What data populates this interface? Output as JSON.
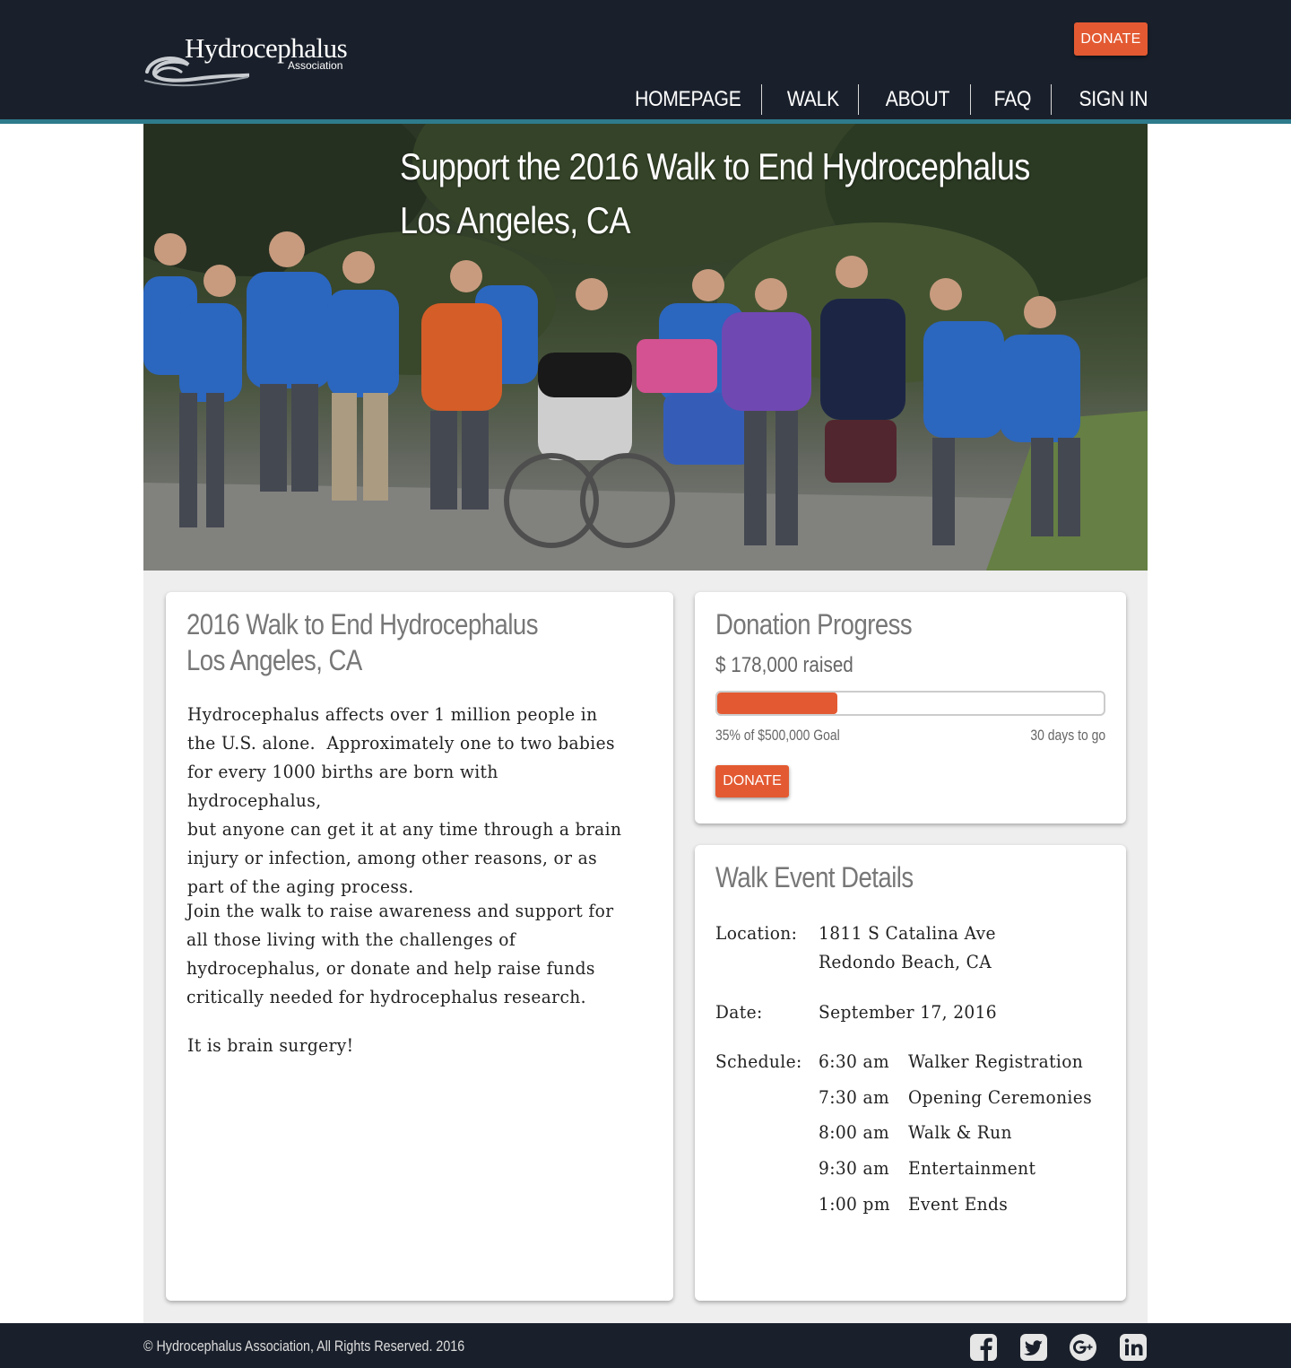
{
  "header": {
    "logo_text": "Hydrocephalus",
    "logo_sub": "Association",
    "donate_label": "DONATE",
    "nav": [
      "HOMEPAGE",
      "WALK",
      "ABOUT",
      "FAQ",
      "SIGN IN"
    ]
  },
  "hero": {
    "title_line1": "Support the 2016 Walk to End Hydrocephalus",
    "title_line2": "Los Angeles, CA"
  },
  "about_card": {
    "title_line1": "2016 Walk to End Hydrocephalus",
    "title_line2": "Los Angeles, CA",
    "paragraph1_lines": [
      "Hydrocephalus affects over 1 million people in",
      "the U.S. alone.  Approximately one to two babies",
      "for every 1000 births are born with hydrocephalus,",
      "but anyone can get it at any time through a brain",
      "injury or infection, among other reasons, or as",
      "part of the aging process."
    ],
    "paragraph2_lines": [
      "Join the walk to raise awareness and support for",
      "all those living with the challenges of",
      "hydrocephalus, or donate and help raise funds",
      "critically needed for hydrocephalus research."
    ],
    "paragraph3": "It is brain surgery!"
  },
  "progress_card": {
    "title": "Donation Progress",
    "raised": "$ 178,000 raised",
    "progress_fraction": 0.31,
    "goal_text": "35% of $500,000 Goal",
    "days_text": "30 days to go",
    "donate_label": "DONATE"
  },
  "details_card": {
    "title": "Walk Event Details",
    "location_label": "Location:",
    "location_line1": "1811 S Catalina Ave",
    "location_line2": "Redondo Beach, CA",
    "date_label": "Date:",
    "date_value": "September 17, 2016",
    "schedule_label": "Schedule:",
    "schedule": [
      {
        "time": "6:30 am",
        "event": "Walker Registration"
      },
      {
        "time": "7:30 am",
        "event": "Opening Ceremonies"
      },
      {
        "time": "8:00 am",
        "event": "Walk & Run"
      },
      {
        "time": "9:30 am",
        "event": "Entertainment"
      },
      {
        "time": "1:00 pm",
        "event": "Event Ends"
      }
    ]
  },
  "footer": {
    "copyright": "©  Hydrocephalus Association, All Rights Reserved. 2016",
    "social": [
      "facebook-icon",
      "twitter-icon",
      "google-plus-icon",
      "linkedin-icon"
    ]
  },
  "colors": {
    "header_bg": "#1a202b",
    "accent_teal": "#2e7b8c",
    "donate_orange": "#e35a32",
    "page_gray": "#eeeeee"
  }
}
